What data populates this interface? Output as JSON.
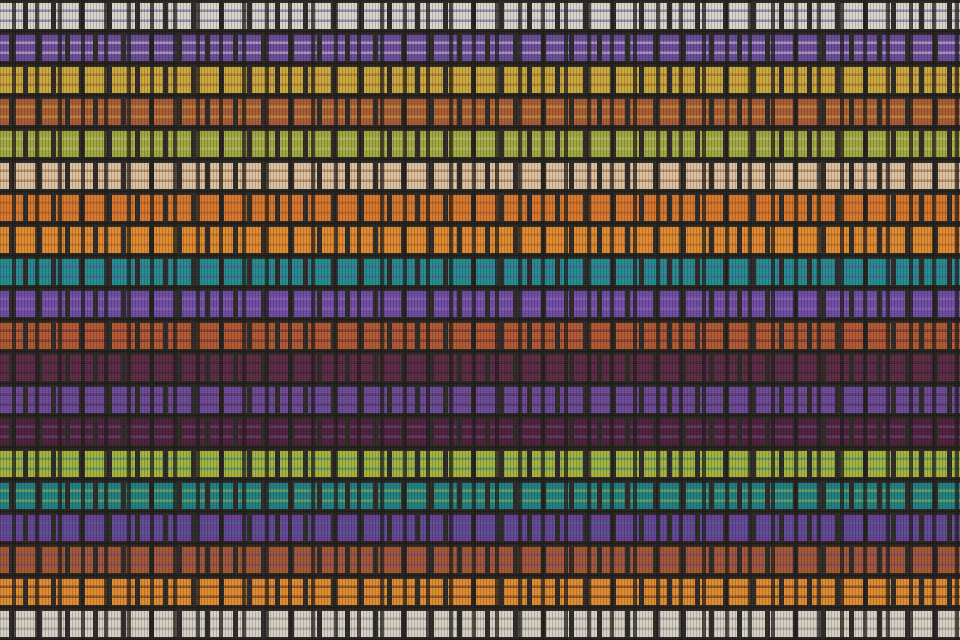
{
  "image": {
    "subject": "woven-textile",
    "colors": {
      "ground": "#2e2a27",
      "warp_line": "#1f1c1a"
    },
    "bands": [
      {
        "name": "white-purple-stripes",
        "color": "#d8d4cc",
        "accent": "#6a4a9a"
      },
      {
        "name": "purple-white-stripes",
        "color": "#6a4a9a",
        "accent": "#d8d4cc"
      },
      {
        "name": "yellow-gold",
        "color": "#c9a93a",
        "accent": "#a95a34"
      },
      {
        "name": "rust-brown",
        "color": "#a95a34",
        "accent": "#c9a93a"
      },
      {
        "name": "olive-green",
        "color": "#9ea83a",
        "accent": "#d2b48a"
      },
      {
        "name": "cream-rust-stripes",
        "color": "#d9c2a0",
        "accent": "#a95a34"
      },
      {
        "name": "orange",
        "color": "#d8772a",
        "accent": "#a65a2c"
      },
      {
        "name": "deep-orange",
        "color": "#e08a2e",
        "accent": "#b0602a"
      },
      {
        "name": "teal",
        "color": "#1f8e8e",
        "accent": "#6e4ba0"
      },
      {
        "name": "violet",
        "color": "#6e4ba0",
        "accent": "#8f6cc2"
      },
      {
        "name": "burnt-orange",
        "color": "#b3582e",
        "accent": "#5c2a44"
      },
      {
        "name": "plum",
        "color": "#5c2a44",
        "accent": "#3f1f34"
      },
      {
        "name": "violet-plum",
        "color": "#6a4a9a",
        "accent": "#5c2a44"
      },
      {
        "name": "burgundy",
        "color": "#4e2138",
        "accent": "#6a4a9a"
      },
      {
        "name": "lime-yellow",
        "color": "#a7b23a",
        "accent": "#1f8e8e"
      },
      {
        "name": "teal-dark",
        "color": "#1e7f84",
        "accent": "#a7b23a"
      },
      {
        "name": "purple",
        "color": "#6b3f96",
        "accent": "#1e7f84"
      },
      {
        "name": "rust-lower",
        "color": "#a5572f",
        "accent": "#6b3f96"
      },
      {
        "name": "orange-stripes",
        "color": "#e08a2e",
        "accent": "#4e2f24"
      },
      {
        "name": "cream-stripes-bottom",
        "color": "#d6d0c6",
        "accent": "#9a8a7a"
      }
    ]
  }
}
